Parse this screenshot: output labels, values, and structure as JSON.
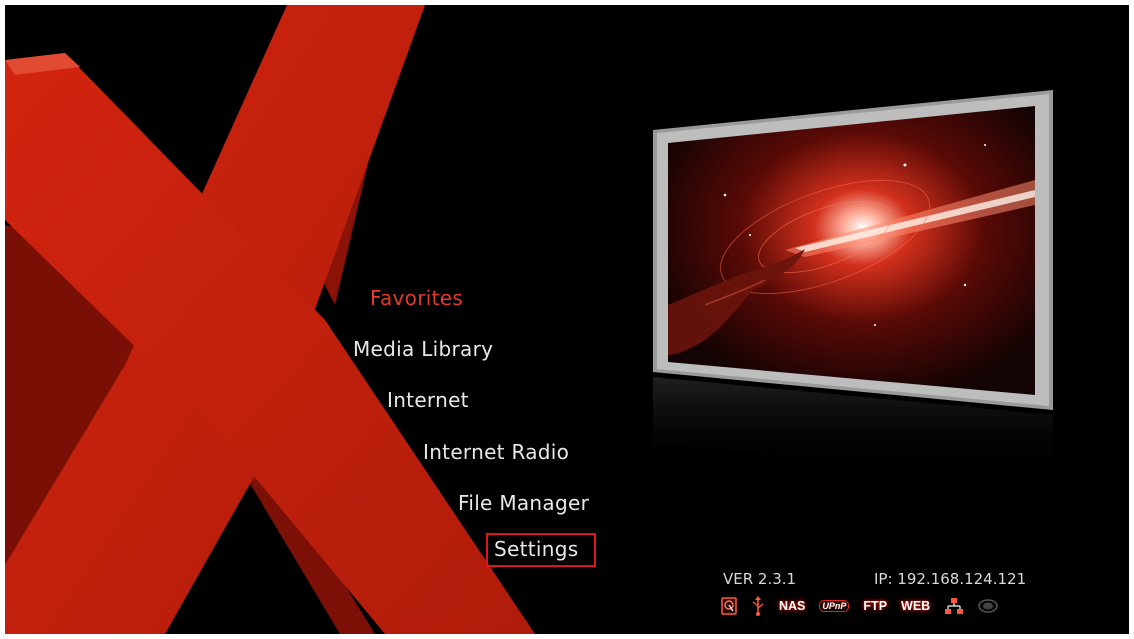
{
  "menu": {
    "items": [
      {
        "label": "Favorites"
      },
      {
        "label": "Media Library"
      },
      {
        "label": "Internet"
      },
      {
        "label": "Internet Radio"
      },
      {
        "label": "File Manager"
      },
      {
        "label": "Settings"
      }
    ],
    "highlighted_index": 0,
    "selected_index": 5
  },
  "status": {
    "version": "VER 2.3.1",
    "ip": "IP: 192.168.124.121",
    "icons": [
      {
        "name": "hdd-icon"
      },
      {
        "name": "usb-icon"
      },
      {
        "name": "nas-icon",
        "text": "NAS"
      },
      {
        "name": "upnp-icon",
        "text": "UPnP"
      },
      {
        "name": "ftp-icon",
        "text": "FTP"
      },
      {
        "name": "web-icon",
        "text": "WEB"
      },
      {
        "name": "network-icon"
      },
      {
        "name": "wifi-icon"
      }
    ]
  },
  "colors": {
    "accent_red": "#c8200e",
    "menu_highlight": "#e23a2c",
    "selection_border": "#e0141c",
    "background": "#000000"
  }
}
